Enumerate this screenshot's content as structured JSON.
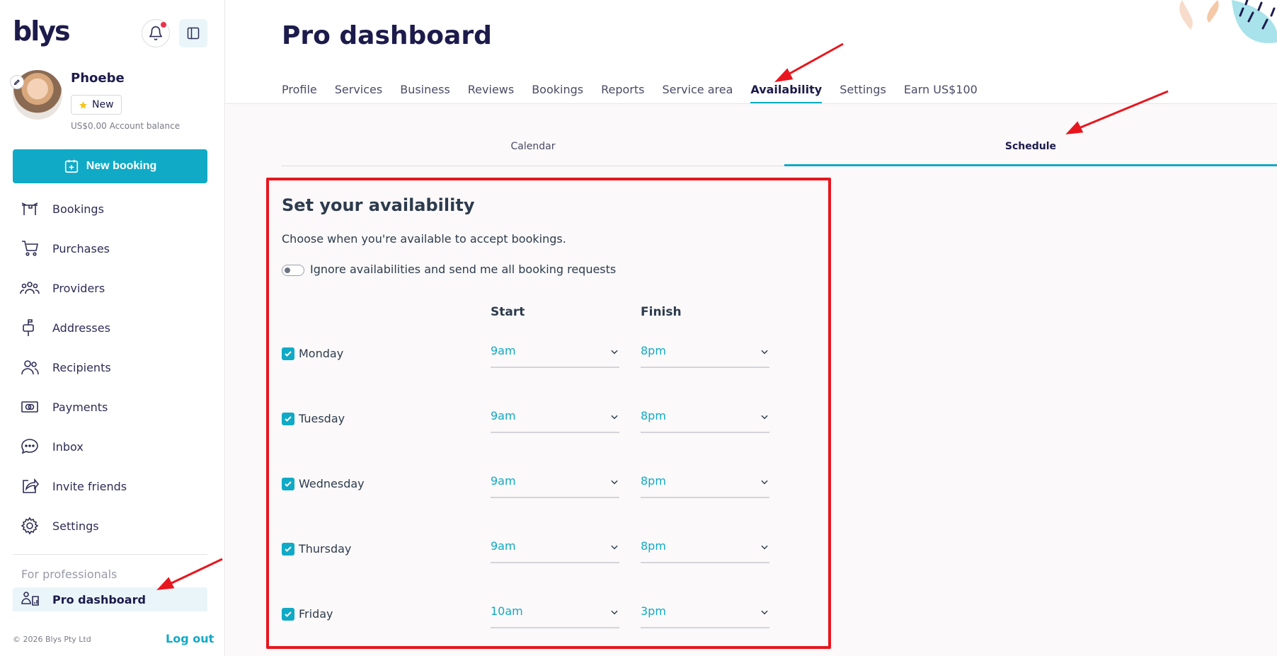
{
  "brand": {
    "logo": "blys"
  },
  "user": {
    "name": "Phoebe",
    "badge": "New",
    "balance": "US$0.00 Account balance"
  },
  "sidebar": {
    "new_booking": "New booking",
    "items": [
      {
        "label": "Bookings",
        "icon": "bookings-icon"
      },
      {
        "label": "Purchases",
        "icon": "cart-icon"
      },
      {
        "label": "Providers",
        "icon": "providers-icon"
      },
      {
        "label": "Addresses",
        "icon": "mailbox-icon"
      },
      {
        "label": "Recipients",
        "icon": "recipients-icon"
      },
      {
        "label": "Payments",
        "icon": "payments-icon"
      },
      {
        "label": "Inbox",
        "icon": "chat-icon"
      },
      {
        "label": "Invite friends",
        "icon": "share-icon"
      },
      {
        "label": "Settings",
        "icon": "gear-icon"
      }
    ],
    "section_label": "For professionals",
    "pro_dashboard": "Pro dashboard",
    "copyright": "© 2026 Blys Pty Ltd",
    "logout": "Log out"
  },
  "main": {
    "title": "Pro dashboard",
    "tabs": [
      "Profile",
      "Services",
      "Business",
      "Reviews",
      "Bookings",
      "Reports",
      "Service area",
      "Availability",
      "Settings",
      "Earn US$100"
    ],
    "active_tab": "Availability",
    "subtabs": {
      "calendar": "Calendar",
      "schedule": "Schedule"
    }
  },
  "availability": {
    "title": "Set your availability",
    "description": "Choose when you're available to accept bookings.",
    "toggle_label": "Ignore availabilities and send me all booking requests",
    "col_start": "Start",
    "col_finish": "Finish",
    "days": [
      {
        "day": "Monday",
        "start": "9am",
        "finish": "8pm",
        "checked": true
      },
      {
        "day": "Tuesday",
        "start": "9am",
        "finish": "8pm",
        "checked": true
      },
      {
        "day": "Wednesday",
        "start": "9am",
        "finish": "8pm",
        "checked": true
      },
      {
        "day": "Thursday",
        "start": "9am",
        "finish": "8pm",
        "checked": true
      },
      {
        "day": "Friday",
        "start": "10am",
        "finish": "3pm",
        "checked": true
      }
    ]
  },
  "colors": {
    "accent": "#10aac6",
    "highlight": "#e8161e",
    "navy": "#1c1b4b"
  }
}
